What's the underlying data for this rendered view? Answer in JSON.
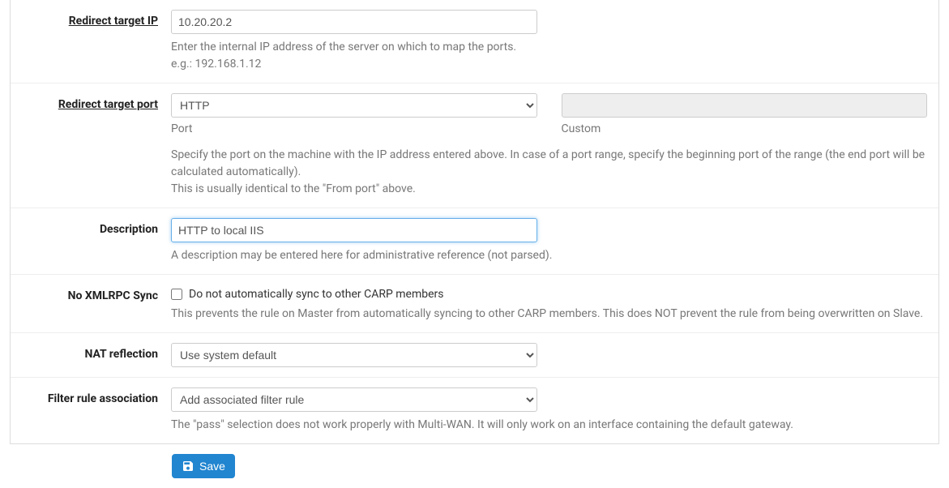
{
  "fields": {
    "redirect_target_ip": {
      "label": "Redirect target IP",
      "value": "10.20.20.2",
      "help": "Enter the internal IP address of the server on which to map the ports.\ne.g.: 192.168.1.12"
    },
    "redirect_target_port": {
      "label": "Redirect target port",
      "port_value": "HTTP",
      "port_sublabel": "Port",
      "custom_sublabel": "Custom",
      "help": "Specify the port on the machine with the IP address entered above. In case of a port range, specify the beginning port of the range (the end port will be calculated automatically).\nThis is usually identical to the \"From port\" above."
    },
    "description": {
      "label": "Description",
      "value": "HTTP to local IIS",
      "help": "A description may be entered here for administrative reference (not parsed)."
    },
    "no_xmlrpc_sync": {
      "label": "No XMLRPC Sync",
      "checkbox_label": "Do not automatically sync to other CARP members",
      "checked": false,
      "help": "This prevents the rule on Master from automatically syncing to other CARP members. This does NOT prevent the rule from being overwritten on Slave."
    },
    "nat_reflection": {
      "label": "NAT reflection",
      "value": "Use system default"
    },
    "filter_rule_association": {
      "label": "Filter rule association",
      "value": "Add associated filter rule",
      "help": "The \"pass\" selection does not work properly with Multi-WAN. It will only work on an interface containing the default gateway."
    }
  },
  "buttons": {
    "save": "Save"
  }
}
